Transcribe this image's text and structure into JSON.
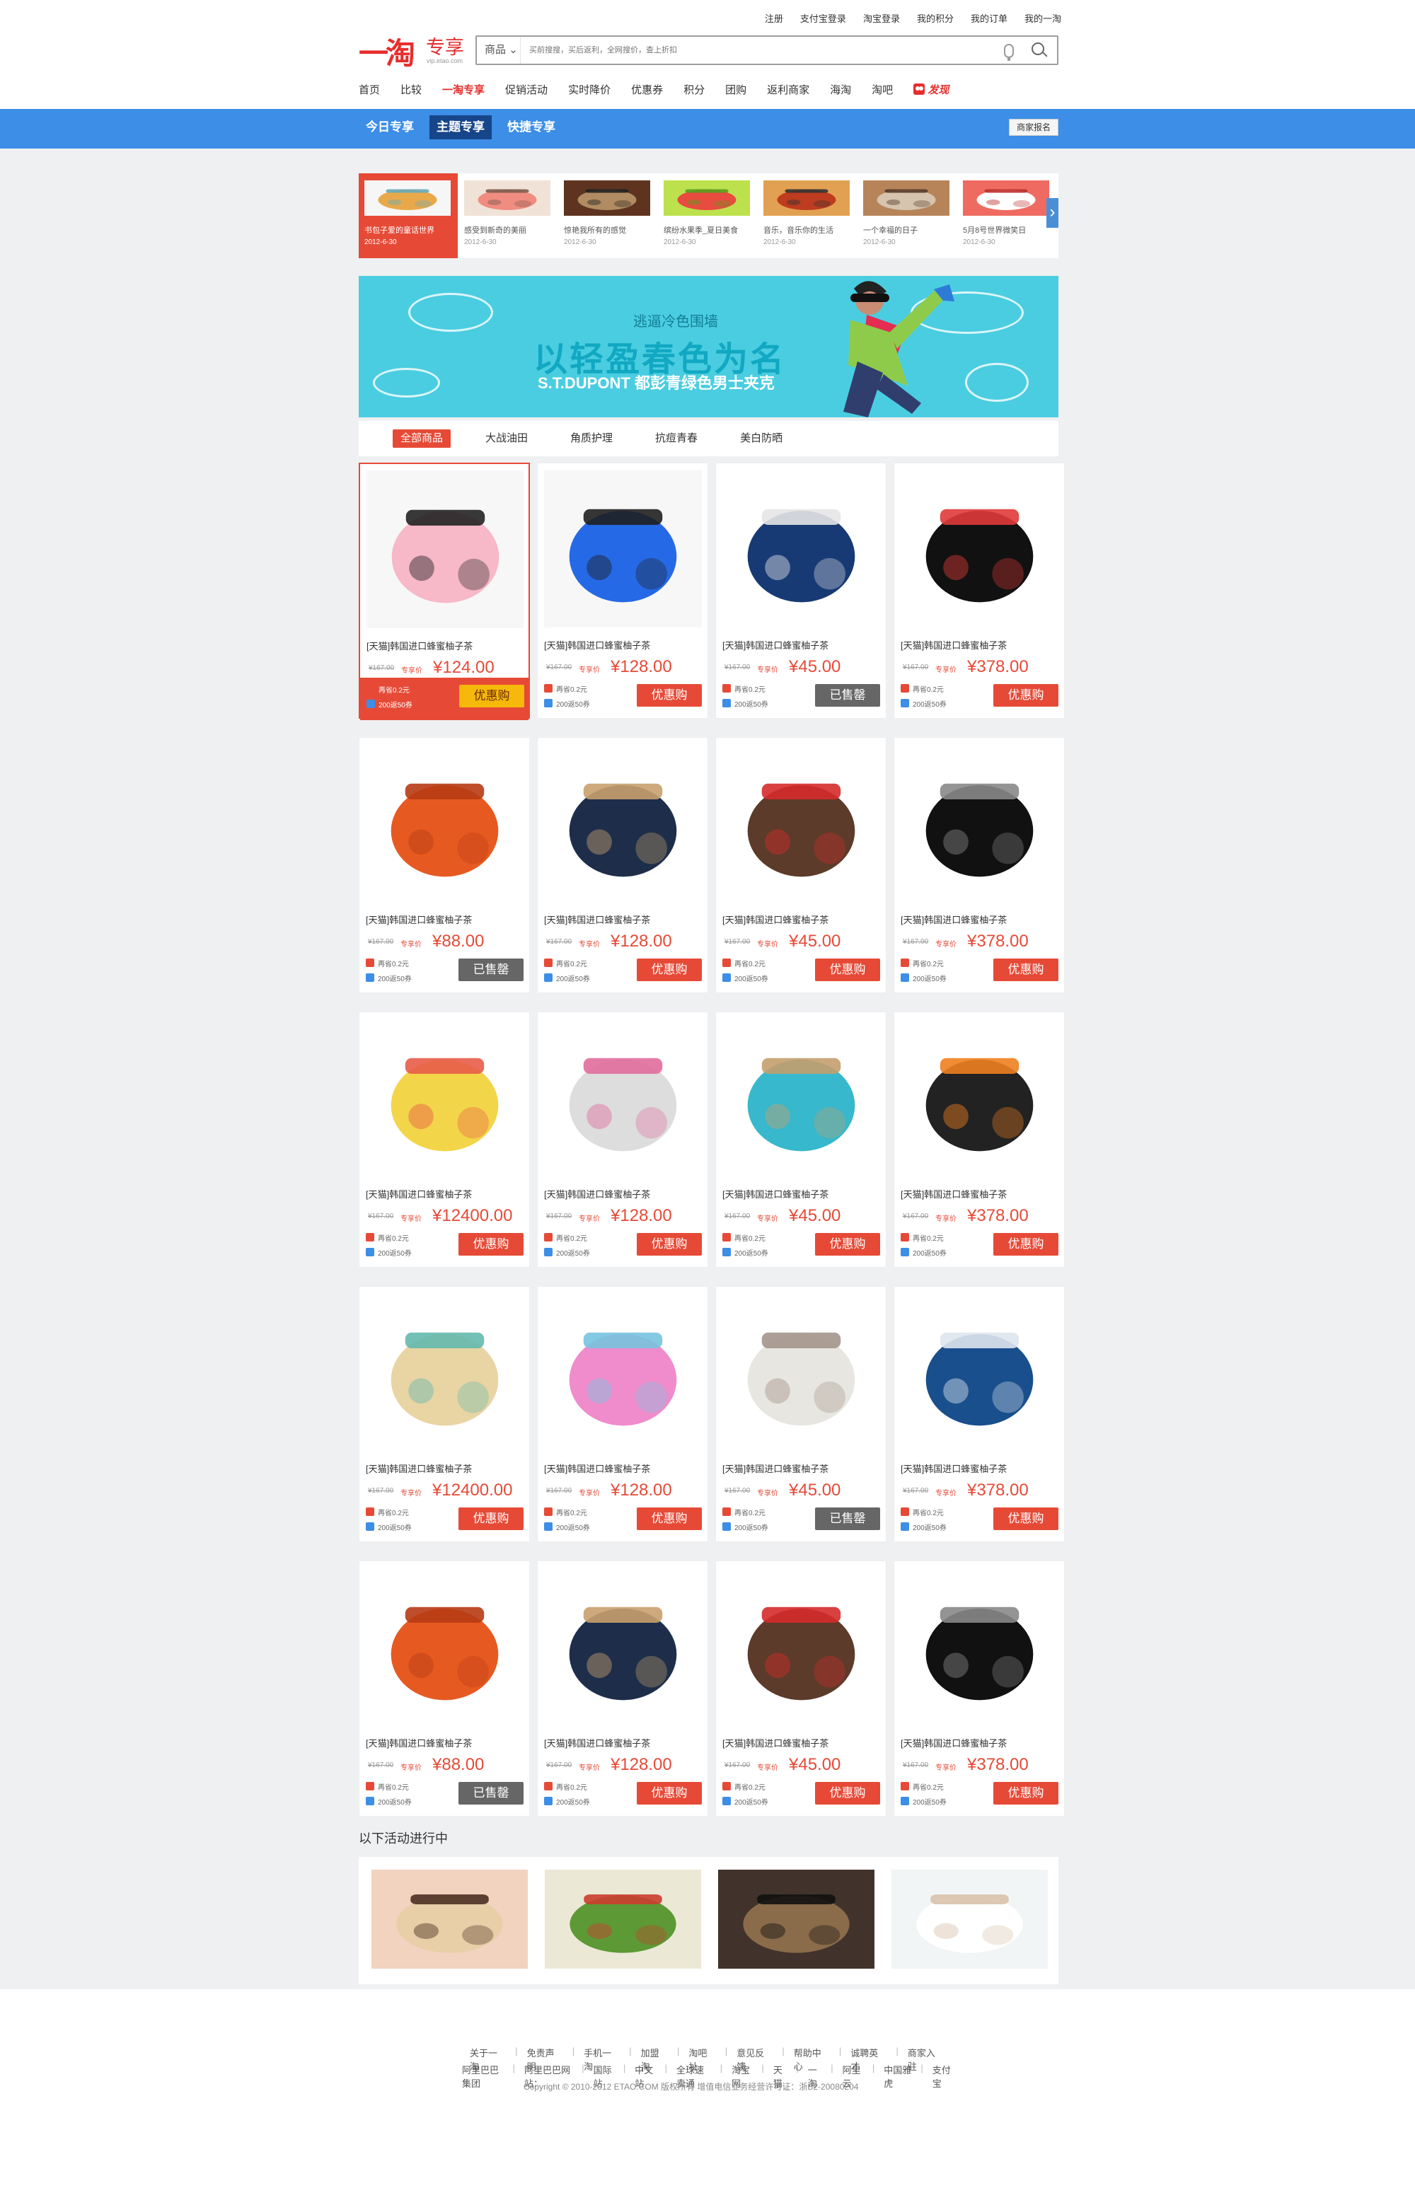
{
  "utility": [
    "注册",
    "支付宝登录",
    "淘宝登录",
    "我的积分",
    "我的订单",
    "我的一淘"
  ],
  "logo": {
    "main": "一淘",
    "sub": "专享",
    "url": "vip.etao.com"
  },
  "search": {
    "type": "商品",
    "placeholder": "买前搜搜，买后返利，全网搜价，查上折扣"
  },
  "nav": [
    "首页",
    "比较",
    "一淘专享",
    "促销活动",
    "实时降价",
    "优惠券",
    "积分",
    "团购",
    "返利商家",
    "海淘",
    "淘吧",
    "发现"
  ],
  "tabs": [
    "今日专享",
    "主题专享",
    "快捷专享"
  ],
  "merchant_button": "商家报名",
  "carousel": [
    {
      "title": "书包子爱的童话世界",
      "date": "2012-6-30",
      "colors": [
        "#f6f6f6",
        "#e9a94a",
        "#68a9b8"
      ]
    },
    {
      "title": "感受到新奇的美丽",
      "date": "2012-6-30",
      "colors": [
        "#f1e2d7",
        "#f08d80",
        "#7d5c4e"
      ]
    },
    {
      "title": "惊艳我所有的感觉",
      "date": "2012-6-30",
      "colors": [
        "#5e3420",
        "#b18b61",
        "#222"
      ]
    },
    {
      "title": "缤纷水果季_夏日美食",
      "date": "2012-6-30",
      "colors": [
        "#bce14d",
        "#e84b3f",
        "#5a9e1f"
      ]
    },
    {
      "title": "音乐，音乐你的生活",
      "date": "2012-6-30",
      "colors": [
        "#e2a152",
        "#be3c1f",
        "#333"
      ]
    },
    {
      "title": "一个幸福的日子",
      "date": "2012-6-30",
      "colors": [
        "#b7845a",
        "#d6c4ae",
        "#563b2a"
      ]
    },
    {
      "title": "5月8号世界微笑日",
      "date": "2012-6-30",
      "colors": [
        "#ef6b61",
        "#fff",
        "#bc302d"
      ]
    }
  ],
  "hero": {
    "kicker": "逃逼冷色围墙",
    "title": "以轻盈春色为名",
    "subtitle": "S.T.DUPONT 都彭青绿色男士夹克"
  },
  "filters": [
    "全部商品",
    "大战油田",
    "角质护理",
    "抗痘青春",
    "美白防晒"
  ],
  "product_common": {
    "title": "[天猫]韩国进口蜂蜜柚子茶",
    "old": "¥167.00",
    "label": "专享价",
    "line1": "再省0.2元",
    "line2": "200返50券"
  },
  "products": [
    {
      "price": "¥124.00",
      "button": "优惠购",
      "style": "yellow",
      "colors": [
        "#f7f7f7",
        "#f7b8c8",
        "#222"
      ]
    },
    {
      "price": "¥128.00",
      "button": "优惠购",
      "style": "red",
      "colors": [
        "#f7f7f7",
        "#2669e6",
        "#1f1f1f"
      ]
    },
    {
      "price": "¥45.00",
      "button": "已售罄",
      "style": "gray",
      "colors": [
        "#fff",
        "#173a75",
        "#e6e6e6"
      ]
    },
    {
      "price": "¥378.00",
      "button": "优惠购",
      "style": "red",
      "colors": [
        "#fff",
        "#111",
        "#e03a3a"
      ]
    },
    {
      "price": "¥88.00",
      "button": "已售罄",
      "style": "gray",
      "colors": [
        "#fff",
        "#e65a21",
        "#b73b14"
      ]
    },
    {
      "price": "¥128.00",
      "button": "优惠购",
      "style": "red",
      "colors": [
        "#fff",
        "#1e2e4a",
        "#c8a06e"
      ]
    },
    {
      "price": "¥45.00",
      "button": "优惠购",
      "style": "red",
      "colors": [
        "#fff",
        "#5c3b2a",
        "#d52b2b"
      ]
    },
    {
      "price": "¥378.00",
      "button": "优惠购",
      "style": "red",
      "colors": [
        "#fff",
        "#111",
        "#888"
      ]
    },
    {
      "price": "¥12400.00",
      "button": "优惠购",
      "style": "red",
      "colors": [
        "#fff",
        "#f3d54a",
        "#e85c49"
      ]
    },
    {
      "price": "¥128.00",
      "button": "优惠购",
      "style": "red",
      "colors": [
        "#fff",
        "#ddd",
        "#e16d9d"
      ]
    },
    {
      "price": "¥45.00",
      "button": "优惠购",
      "style": "red",
      "colors": [
        "#fff",
        "#37b8cc",
        "#c49f6e"
      ]
    },
    {
      "price": "¥378.00",
      "button": "优惠购",
      "style": "red",
      "colors": [
        "#fff",
        "#222",
        "#ef7f20"
      ]
    },
    {
      "price": "¥12400.00",
      "button": "优惠购",
      "style": "red",
      "colors": [
        "#fff",
        "#e9d4a4",
        "#64b9ae"
      ]
    },
    {
      "price": "¥128.00",
      "button": "优惠购",
      "style": "red",
      "colors": [
        "#fff",
        "#f08ccc",
        "#77c3df"
      ]
    },
    {
      "price": "¥45.00",
      "button": "已售罄",
      "style": "gray",
      "colors": [
        "#fff",
        "#e8e6e0",
        "#a4958c"
      ]
    },
    {
      "price": "¥378.00",
      "button": "优惠购",
      "style": "red",
      "colors": [
        "#fff",
        "#194f8c",
        "#dfe6ed"
      ]
    },
    {
      "price": "¥88.00",
      "button": "已售罄",
      "style": "gray",
      "colors": [
        "#fff",
        "#e65a21",
        "#b73b14"
      ]
    },
    {
      "price": "¥128.00",
      "button": "优惠购",
      "style": "red",
      "colors": [
        "#fff",
        "#1e2e4a",
        "#c8a06e"
      ]
    },
    {
      "price": "¥45.00",
      "button": "优惠购",
      "style": "red",
      "colors": [
        "#fff",
        "#5c3b2a",
        "#d52b2b"
      ]
    },
    {
      "price": "¥378.00",
      "button": "优惠购",
      "style": "red",
      "colors": [
        "#fff",
        "#111",
        "#888"
      ]
    }
  ],
  "section_title": "以下活动进行中",
  "activities": [
    {
      "colors": [
        "#f1d3c0",
        "#e8cfa7",
        "#4b2f22"
      ]
    },
    {
      "colors": [
        "#ece8d6",
        "#5d9935",
        "#cc3d2f"
      ]
    },
    {
      "colors": [
        "#41332b",
        "#8a6c4a",
        "#111"
      ]
    },
    {
      "colors": [
        "#f2f5f5",
        "#fff",
        "#d8c2ab"
      ]
    }
  ],
  "footer": {
    "links": [
      "关于一淘",
      "免责声明",
      "手机一淘",
      "加盟淘",
      "淘吧址",
      "意见反馈",
      "帮助中心",
      "诚聘英才",
      "商家入驻"
    ],
    "group": [
      "阿里巴巴集团",
      "阿里巴巴网站：",
      "国际站",
      "中文站",
      "全球速卖通",
      "淘宝网",
      "天猫",
      "一淘",
      "阿里云",
      "中国雅虎",
      "支付宝"
    ],
    "copyright": "Copyright © 2010-2012 ETAO.COM 版权所有  增值电信业务经营许可证：浙B2-20080204"
  }
}
